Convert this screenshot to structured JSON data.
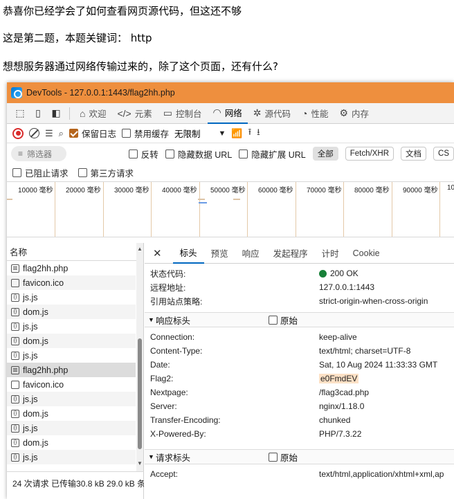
{
  "page": {
    "line1": "恭喜你已经学会了如何查看网页源代码，但这还不够",
    "line2": "这是第二题，本题关键词： http",
    "line3": "想想服务器通过网络传输过来的，除了这个页面，还有什么?"
  },
  "devtools": {
    "title": "DevTools - 127.0.0.1:1443/flag2hh.php",
    "tabs": [
      {
        "label": "欢迎",
        "icon": "home-icon"
      },
      {
        "label": "元素",
        "icon": "code-icon"
      },
      {
        "label": "控制台",
        "icon": "console-icon"
      },
      {
        "label": "网络",
        "icon": "wifi-icon"
      },
      {
        "label": "源代码",
        "icon": "bug-icon"
      },
      {
        "label": "性能",
        "icon": "performance-icon"
      },
      {
        "label": "内存",
        "icon": "memory-icon"
      }
    ],
    "active_tab": "网络",
    "toolbar": {
      "preserve_log": "保留日志",
      "disable_cache": "禁用缓存",
      "throttling": "无限制"
    },
    "filter": {
      "placeholder": "筛选器",
      "invert": "反转",
      "hide_data_url": "隐藏数据 URL",
      "hide_ext_url": "隐藏扩展 URL",
      "all": "全部",
      "fetch_xhr": "Fetch/XHR",
      "doc": "文档",
      "css_partial": "CS",
      "blocked_requests": "已阻止请求",
      "third_party": "第三方请求"
    },
    "timeline_ticks": [
      "10000 毫秒",
      "20000 毫秒",
      "30000 毫秒",
      "40000 毫秒",
      "50000 毫秒",
      "60000 毫秒",
      "70000 毫秒",
      "80000 毫秒",
      "90000 毫秒",
      "10"
    ],
    "list": {
      "header": "名称",
      "rows": [
        {
          "name": "flag2hh.php",
          "type": "doc"
        },
        {
          "name": "favicon.ico",
          "type": "img"
        },
        {
          "name": "js.js",
          "type": "script"
        },
        {
          "name": "dom.js",
          "type": "script"
        },
        {
          "name": "js.js",
          "type": "script"
        },
        {
          "name": "dom.js",
          "type": "script"
        },
        {
          "name": "js.js",
          "type": "script"
        },
        {
          "name": "flag2hh.php",
          "type": "doc"
        },
        {
          "name": "favicon.ico",
          "type": "img"
        },
        {
          "name": "js.js",
          "type": "script"
        },
        {
          "name": "dom.js",
          "type": "script"
        },
        {
          "name": "js.js",
          "type": "script"
        },
        {
          "name": "dom.js",
          "type": "script"
        },
        {
          "name": "js.js",
          "type": "script"
        }
      ],
      "selected_index": 7,
      "status": "24 次请求  已传输30.8 kB  29.0 kB 条"
    },
    "detail": {
      "tabs": [
        "标头",
        "预览",
        "响应",
        "发起程序",
        "计时",
        "Cookie"
      ],
      "active_tab": "标头",
      "general": [
        {
          "k": "状态代码:",
          "v": "200 OK"
        },
        {
          "k": "远程地址:",
          "v": "127.0.0.1:1443"
        },
        {
          "k": "引用站点策略:",
          "v": "strict-origin-when-cross-origin"
        }
      ],
      "response_section": "响应标头",
      "request_section": "请求标头",
      "raw_label": "原始",
      "response_headers": [
        {
          "k": "Connection:",
          "v": "keep-alive"
        },
        {
          "k": "Content-Type:",
          "v": "text/html; charset=UTF-8"
        },
        {
          "k": "Date:",
          "v": "Sat, 10 Aug 2024 11:33:33 GMT"
        },
        {
          "k": "Flag2:",
          "v": "e0FmdEV"
        },
        {
          "k": "Nextpage:",
          "v": "/flag3cad.php"
        },
        {
          "k": "Server:",
          "v": "nginx/1.18.0"
        },
        {
          "k": "Transfer-Encoding:",
          "v": "chunked"
        },
        {
          "k": "X-Powered-By:",
          "v": "PHP/7.3.22"
        }
      ],
      "request_headers": [
        {
          "k": "Accept:",
          "v": "text/html,application/xhtml+xml,ap"
        }
      ]
    }
  },
  "colors": {
    "titlebar": "#ee8f3e",
    "accent": "#0067c0",
    "record": "#d92b2b",
    "status_ok": "#188038",
    "highlight": "#fde1c6"
  }
}
